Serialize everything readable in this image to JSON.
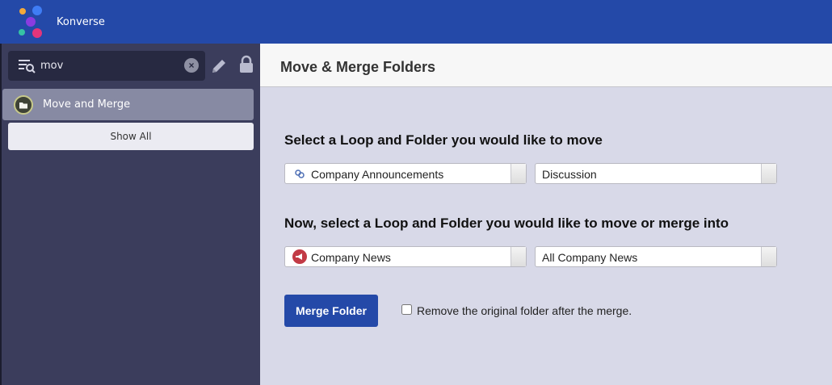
{
  "app": {
    "title": "Konverse"
  },
  "sidebar": {
    "search": {
      "value": "mov"
    },
    "results": [
      {
        "label": "Move and Merge"
      }
    ],
    "show_all_label": "Show All"
  },
  "main": {
    "title": "Move & Merge Folders",
    "source_heading": "Select a Loop and Folder you would like to move",
    "source_loop": "Company Announcements",
    "source_folder": "Discussion",
    "target_heading": "Now, select a Loop and Folder you would like to move or merge into",
    "target_loop": "Company News",
    "target_folder": "All Company News",
    "merge_button": "Merge Folder",
    "remove_checkbox_label": "Remove the original folder after the merge.",
    "remove_checkbox_checked": false
  },
  "colors": {
    "brand_blue": "#2449a8",
    "sidebar_bg": "#3b3d5c",
    "content_bg": "#d8d9e8"
  },
  "icons": [
    "konverse-logo",
    "search-menu-icon",
    "clear-icon",
    "pencil-icon",
    "lock-icon",
    "folder-avatar-icon",
    "chat-loop-icon",
    "megaphone-loop-icon",
    "dropdown-arrow-icon"
  ]
}
